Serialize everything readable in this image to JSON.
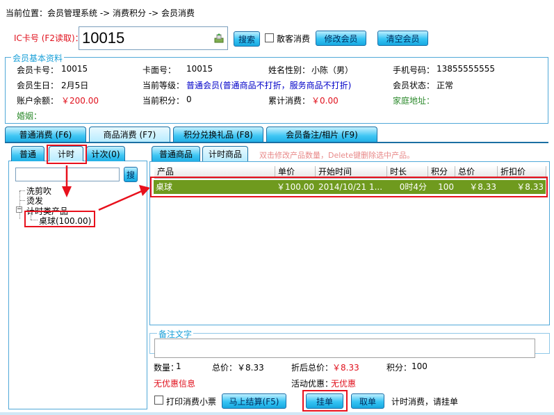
{
  "breadcrumb": "当前位置：会员管理系统 -> 消费积分 -> 会员消费",
  "ic_card": {
    "label": "IC卡号 (F2读取)：",
    "value": "10015",
    "search_btn": "搜索",
    "guest_label": "散客消费",
    "modify_btn": "修改会员",
    "clear_btn": "清空会员"
  },
  "member_info": {
    "title": "会员基本资料",
    "card_no_label": "会员卡号：",
    "card_no": "10015",
    "face_no_label": "卡面号：",
    "face_no": "10015",
    "name_label": "姓名性别：",
    "name": "小陈（男）",
    "phone_label": "手机号码：",
    "phone": "13855555555",
    "birthday_label": "会员生日：",
    "birthday": "2月5日",
    "level_label": "当前等级：",
    "level": "普通会员(普通商品不打折，服务商品不打折)",
    "status_label": "会员状态：",
    "status": "正常",
    "balance_label": "账户余额：",
    "balance": "￥200.00",
    "points_label": "当前积分：",
    "points": "0",
    "total_label": "累计消费：",
    "total": "￥0.00",
    "address_label": "家庭地址：",
    "marriage_label": "婚姻："
  },
  "main_tabs": [
    "普通消费 (F6)",
    "商品消费 (F7)",
    "积分兑换礼品 (F8)",
    "会员备注/相片 (F9)"
  ],
  "left_tabs": [
    "普通",
    "计时",
    "计次(0)"
  ],
  "search_btn2": "搜",
  "tree": {
    "items": [
      "洗剪吹",
      "烫发",
      "计时类产品"
    ],
    "child": "桌球(100.00)"
  },
  "right_tabs": [
    "普通商品",
    "计时商品"
  ],
  "hint": "双击修改产品数量，Delete键删除选中产品。",
  "grid": {
    "headers": [
      "产品",
      "单价",
      "开始时间",
      "时长",
      "积分",
      "总价",
      "折扣价"
    ],
    "row": [
      "桌球",
      "￥100.00",
      "2014/10/21 1...",
      "0时4分",
      "100",
      "￥8.33",
      "￥8.33"
    ]
  },
  "remark_title": "备注文字",
  "summary": {
    "qty_label": "数量：",
    "qty": "1",
    "total_label": "总价：",
    "total": "￥8.33",
    "disc_label": "折后总价：",
    "disc": "￥8.33",
    "points_label": "积分：",
    "points": "100",
    "no_discount": "无优惠信息",
    "promo_label": "活动优惠：",
    "promo": "无优惠"
  },
  "bottom": {
    "print_label": "打印消费小票",
    "checkout_btn": "马上结算(F5)",
    "hang_btn": "挂单",
    "fetch_btn": "取单",
    "status_text": "计时消费，请挂单"
  }
}
